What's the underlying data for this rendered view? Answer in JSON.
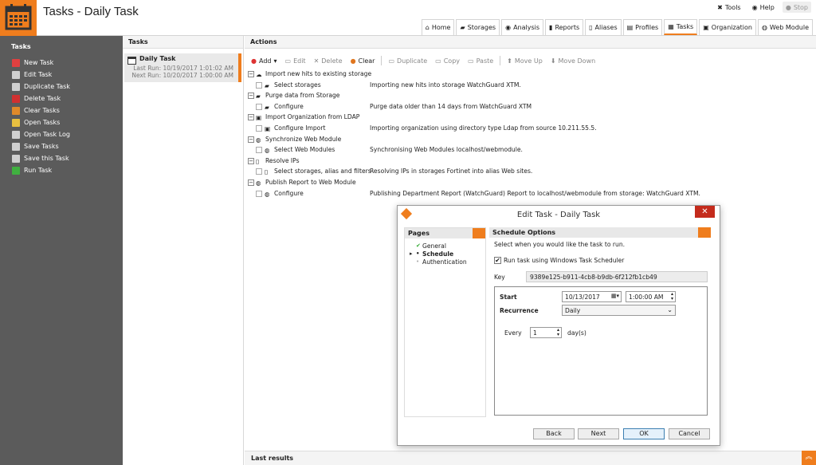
{
  "app": {
    "title": "Tasks - Daily Task",
    "accent": "#ef7d1d"
  },
  "top_links": [
    {
      "label": "Tools",
      "icon": "tools-icon"
    },
    {
      "label": "Help",
      "icon": "help-icon"
    },
    {
      "label": "Stop",
      "icon": "stop-icon"
    }
  ],
  "main_tabs": [
    {
      "label": "Home",
      "icon": "home-icon"
    },
    {
      "label": "Storages",
      "icon": "folder-icon"
    },
    {
      "label": "Analysis",
      "icon": "eye-icon"
    },
    {
      "label": "Reports",
      "icon": "bar-chart-icon"
    },
    {
      "label": "Aliases",
      "icon": "book-icon"
    },
    {
      "label": "Profiles",
      "icon": "profile-icon"
    },
    {
      "label": "Tasks",
      "icon": "calendar-icon",
      "active": true
    },
    {
      "label": "Organization",
      "icon": "organization-icon"
    },
    {
      "label": "Web Module",
      "icon": "globe-icon"
    }
  ],
  "sidebar": {
    "title": "Tasks",
    "items": [
      {
        "label": "New Task",
        "color": "#e04040"
      },
      {
        "label": "Edit Task",
        "color": "#d0d0d0"
      },
      {
        "label": "Duplicate Task",
        "color": "#d0d0d0"
      },
      {
        "label": "Delete Task",
        "color": "#d03030"
      },
      {
        "label": "Clear Tasks",
        "color": "#e08a2a"
      },
      {
        "label": "Open Tasks",
        "color": "#e8c040"
      },
      {
        "label": "Open Task Log",
        "color": "#d0d0d0"
      },
      {
        "label": "Save Tasks",
        "color": "#d0d0d0"
      },
      {
        "label": "Save this Task",
        "color": "#d0d0d0"
      },
      {
        "label": "Run Task",
        "color": "#40b040"
      }
    ]
  },
  "tasks_panel": {
    "header": "Tasks",
    "task": {
      "name": "Daily Task",
      "last_run": "Last Run: 10/19/2017 1:01:02 AM",
      "next_run": "Next Run: 10/20/2017 1:00:00 AM"
    }
  },
  "actions_panel": {
    "header": "Actions",
    "toolbar": {
      "add": "Add",
      "edit": "Edit",
      "delete": "Delete",
      "clear": "Clear",
      "duplicate": "Duplicate",
      "copy": "Copy",
      "paste": "Paste",
      "move_up": "Move Up",
      "move_down": "Move Down"
    },
    "tree": [
      {
        "label": "Import new hits to existing storage",
        "icon": "cloud-icon",
        "child": {
          "label": "Select storages",
          "icon": "folder-open-icon",
          "desc": "Importing new hits into storage WatchGuard XTM."
        }
      },
      {
        "label": "Purge data from Storage",
        "icon": "folder-open-icon",
        "child": {
          "label": "Configure",
          "icon": "folder-open-icon",
          "desc": "Purge data older than 14 days from WatchGuard XTM"
        }
      },
      {
        "label": "Import Organization from LDAP",
        "icon": "organization-icon",
        "child": {
          "label": "Configure Import",
          "icon": "organization-icon",
          "desc": "Importing organization using directory type Ldap from source 10.211.55.5."
        }
      },
      {
        "label": "Synchronize Web Module",
        "icon": "globe-icon",
        "child": {
          "label": "Select Web Modules",
          "icon": "globe-icon",
          "desc": "Synchronising Web Modules localhost/webmodule."
        }
      },
      {
        "label": "Resolve IPs",
        "icon": "book-icon",
        "child": {
          "label": "Select storages, alias and filters",
          "icon": "book-icon",
          "desc": "Resolving IPs in storages Fortinet into alias Web sites."
        }
      },
      {
        "label": "Publish Report to Web Module",
        "icon": "globe-icon",
        "child": {
          "label": "Configure",
          "icon": "globe-icon",
          "desc": "Publishing Department Report (WatchGuard) Report to localhost/webmodule from storage: WatchGuard XTM."
        }
      }
    ],
    "last_results": "Last results"
  },
  "dialog": {
    "title": "Edit Task - Daily Task",
    "close": "✕",
    "pages": {
      "header": "Pages",
      "items": [
        {
          "label": "General",
          "marker": "✔"
        },
        {
          "label": "Schedule",
          "marker": "•",
          "current": true
        },
        {
          "label": "Authentication",
          "marker": "•"
        }
      ]
    },
    "schedule": {
      "header": "Schedule Options",
      "description": "Select when you would like the task to run.",
      "use_scheduler_label": "Run task using Windows Task Scheduler",
      "use_scheduler_checked": true,
      "key_label": "Key",
      "key_value": "9389e125-b911-4cb8-b9db-6f212fb1cb49",
      "start_label": "Start",
      "start_date": "10/13/2017",
      "start_time": "1:00:00 AM",
      "recurrence_label": "Recurrence",
      "recurrence_value": "Daily",
      "every_label": "Every",
      "every_value": "1",
      "every_unit": "day(s)"
    },
    "buttons": {
      "back": "Back",
      "next": "Next",
      "ok": "OK",
      "cancel": "Cancel"
    }
  }
}
